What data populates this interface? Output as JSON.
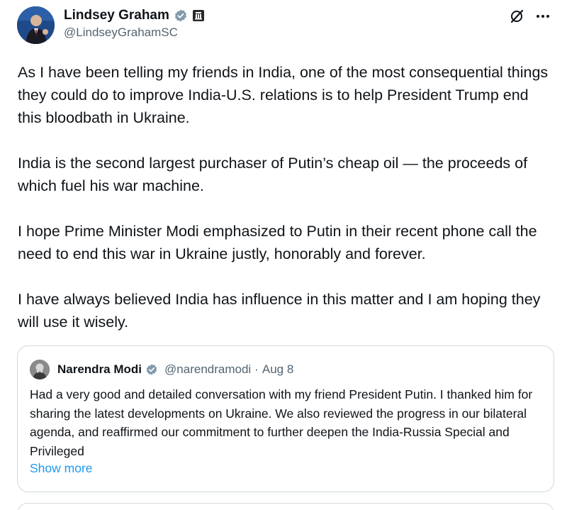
{
  "author": {
    "display_name": "Lindsey Graham",
    "handle": "@LindseyGrahamSC",
    "verified_icon": "verified-badge-icon",
    "affiliation_icon": "government-badge-icon"
  },
  "actions": {
    "grok_icon": "grok-icon",
    "more_icon": "more-options-icon"
  },
  "tweet": {
    "paragraphs": [
      "As I have been telling my friends in India, one of the most consequential things they could do to improve India-U.S. relations is to help President Trump end this bloodbath in Ukraine.",
      "India is the second largest purchaser of Putin’s cheap oil — the proceeds of which fuel his war machine.",
      "I hope Prime Minister Modi emphasized to Putin in their recent phone call the need to end this war in Ukraine justly, honorably and forever.",
      "I have always believed India has influence in this matter and I am hoping they will use it wisely."
    ]
  },
  "quoted": {
    "display_name": "Narendra Modi",
    "handle": "@narendramodi",
    "separator": "·",
    "date": "Aug 8",
    "text": "Had a very good and detailed conversation with my friend President Putin. I thanked him for sharing the latest developments on Ukraine. We also reviewed the progress in our bilateral agenda, and reaffirmed our commitment to further deepen the India-Russia Special and Privileged",
    "show_more": "Show more"
  },
  "colors": {
    "text": "#0f1419",
    "secondary": "#536471",
    "link": "#1d9bf0",
    "verified": "#829aab",
    "border": "#cfd9de"
  }
}
